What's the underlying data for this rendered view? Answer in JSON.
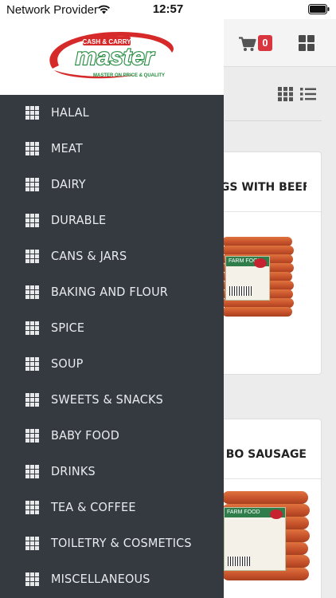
{
  "status_bar": {
    "carrier": "Network Provider",
    "time": "12:57"
  },
  "header": {
    "cart_count": "0"
  },
  "logo": {
    "top_text": "CASH & CARRY",
    "brand": "master",
    "tagline": "MASTER ON PRICE & QUALITY"
  },
  "menu": {
    "items": [
      {
        "label": "HALAL"
      },
      {
        "label": "MEAT"
      },
      {
        "label": "DAIRY"
      },
      {
        "label": "DURABLE"
      },
      {
        "label": "CANS & JARS"
      },
      {
        "label": "BAKING AND FLOUR"
      },
      {
        "label": "SPICE"
      },
      {
        "label": "SOUP"
      },
      {
        "label": "SWEETS & SNACKS"
      },
      {
        "label": "BABY FOOD"
      },
      {
        "label": "DRINKS"
      },
      {
        "label": "TEA & COFFEE"
      },
      {
        "label": "TOILETRY & COSMETICS"
      },
      {
        "label": "MISCELLANEOUS"
      }
    ]
  },
  "products": [
    {
      "title_visible": "OGS WITH BEEF",
      "label_brand": "FARM FOOD"
    },
    {
      "title_visible": "BO SAUSAGE",
      "label_brand": "FARM FOOD"
    }
  ],
  "colors": {
    "drawer_bg": "#343a40",
    "badge": "#d9353e",
    "brand_red": "#d62a2a",
    "brand_green": "#1f8a3b"
  }
}
